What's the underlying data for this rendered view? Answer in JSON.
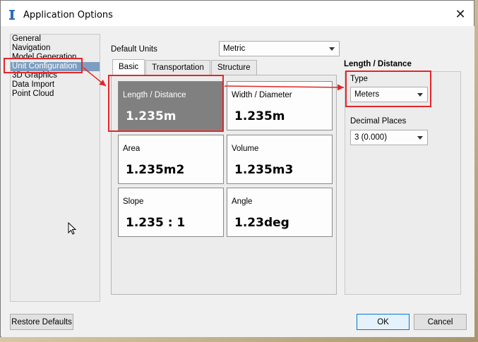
{
  "window": {
    "title": "Application Options",
    "close_glyph": "✕"
  },
  "nav": {
    "items": [
      {
        "label": "General",
        "selected": false
      },
      {
        "label": "Navigation",
        "selected": false
      },
      {
        "label": "Model Generation",
        "selected": false
      },
      {
        "label": "Unit Configuration",
        "selected": true
      },
      {
        "label": "3D Graphics",
        "selected": false
      },
      {
        "label": "Data Import",
        "selected": false
      },
      {
        "label": "Point Cloud",
        "selected": false
      }
    ]
  },
  "default_units": {
    "label": "Default Units",
    "value": "Metric"
  },
  "tabs": [
    {
      "label": "Basic",
      "active": true
    },
    {
      "label": "Transportation",
      "active": false
    },
    {
      "label": "Structure",
      "active": false
    }
  ],
  "unit_cards": [
    {
      "label": "Length / Distance",
      "value": "1.235m",
      "selected": true
    },
    {
      "label": "Width / Diameter",
      "value": "1.235m",
      "selected": false
    },
    {
      "label": "Area",
      "value": "1.235m2",
      "selected": false
    },
    {
      "label": "Volume",
      "value": "1.235m3",
      "selected": false
    },
    {
      "label": "Slope",
      "value": "1.235 : 1",
      "selected": false
    },
    {
      "label": "Angle",
      "value": "1.23deg",
      "selected": false
    }
  ],
  "details": {
    "title": "Length / Distance",
    "type_label": "Type",
    "type_value": "Meters",
    "decimal_label": "Decimal Places",
    "decimal_value": "3  (0.000)"
  },
  "buttons": {
    "restore": "Restore Defaults",
    "ok": "OK",
    "cancel": "Cancel"
  },
  "colors": {
    "selection": "#7c9ec0",
    "selected_card": "#808080",
    "annotation": "#e3262a"
  }
}
